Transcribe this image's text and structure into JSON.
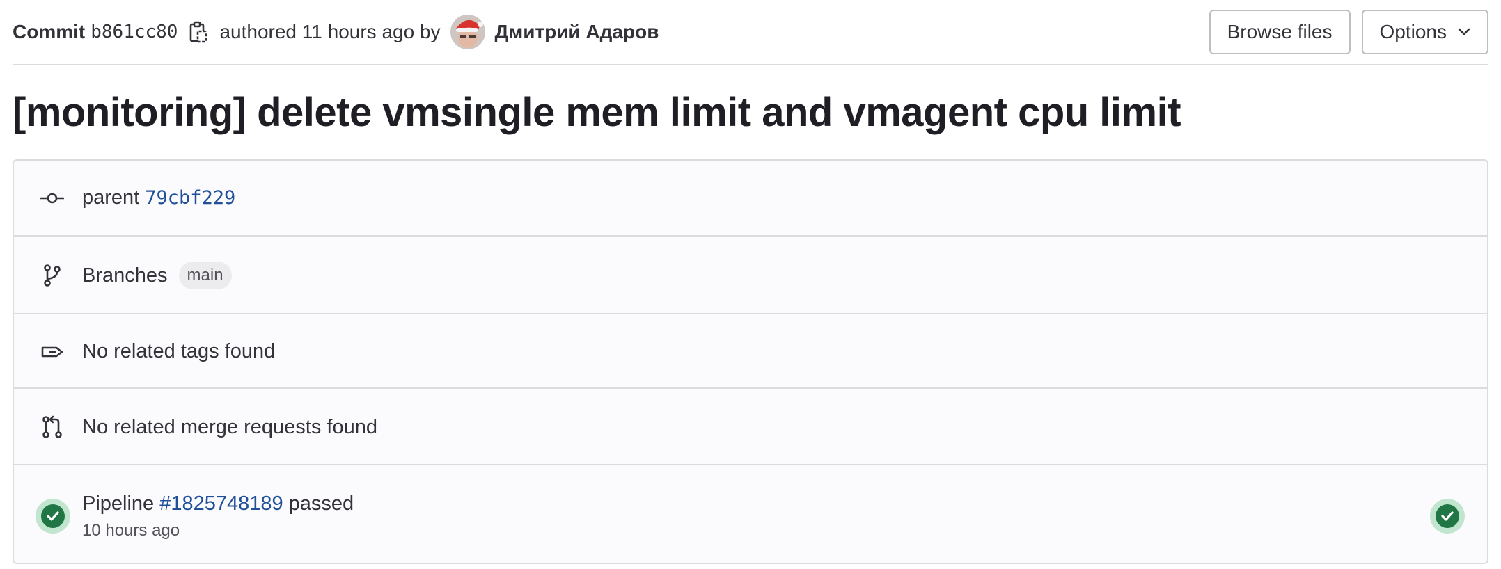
{
  "header": {
    "commit_label": "Commit",
    "commit_sha": "b861cc80",
    "authored_text": "authored 11 hours ago by",
    "author_name": "Дмитрий Адаров",
    "browse_files_label": "Browse files",
    "options_label": "Options"
  },
  "commit_title": "[monitoring] delete vmsingle mem limit and vmagent cpu limit",
  "info": {
    "parent_label": "parent",
    "parent_sha": "79cbf229",
    "branches_label": "Branches",
    "branch_name": "main",
    "tags_text": "No related tags found",
    "merge_requests_text": "No related merge requests found",
    "pipeline_label": "Pipeline",
    "pipeline_id": "#1825748189",
    "pipeline_status": "passed",
    "pipeline_time": "10 hours ago"
  },
  "colors": {
    "link": "#1f4f99",
    "success": "#217645",
    "success_bg": "#c2e5cf",
    "border": "#dcdcde",
    "panel_bg": "#fbfafd"
  },
  "icons": {
    "copy": "clipboard-icon",
    "parent": "commit-icon",
    "branches": "branch-icon",
    "tags": "tag-icon",
    "merge_requests": "merge-request-icon",
    "pipeline": "status-success-icon",
    "options": "chevron-down-icon"
  }
}
